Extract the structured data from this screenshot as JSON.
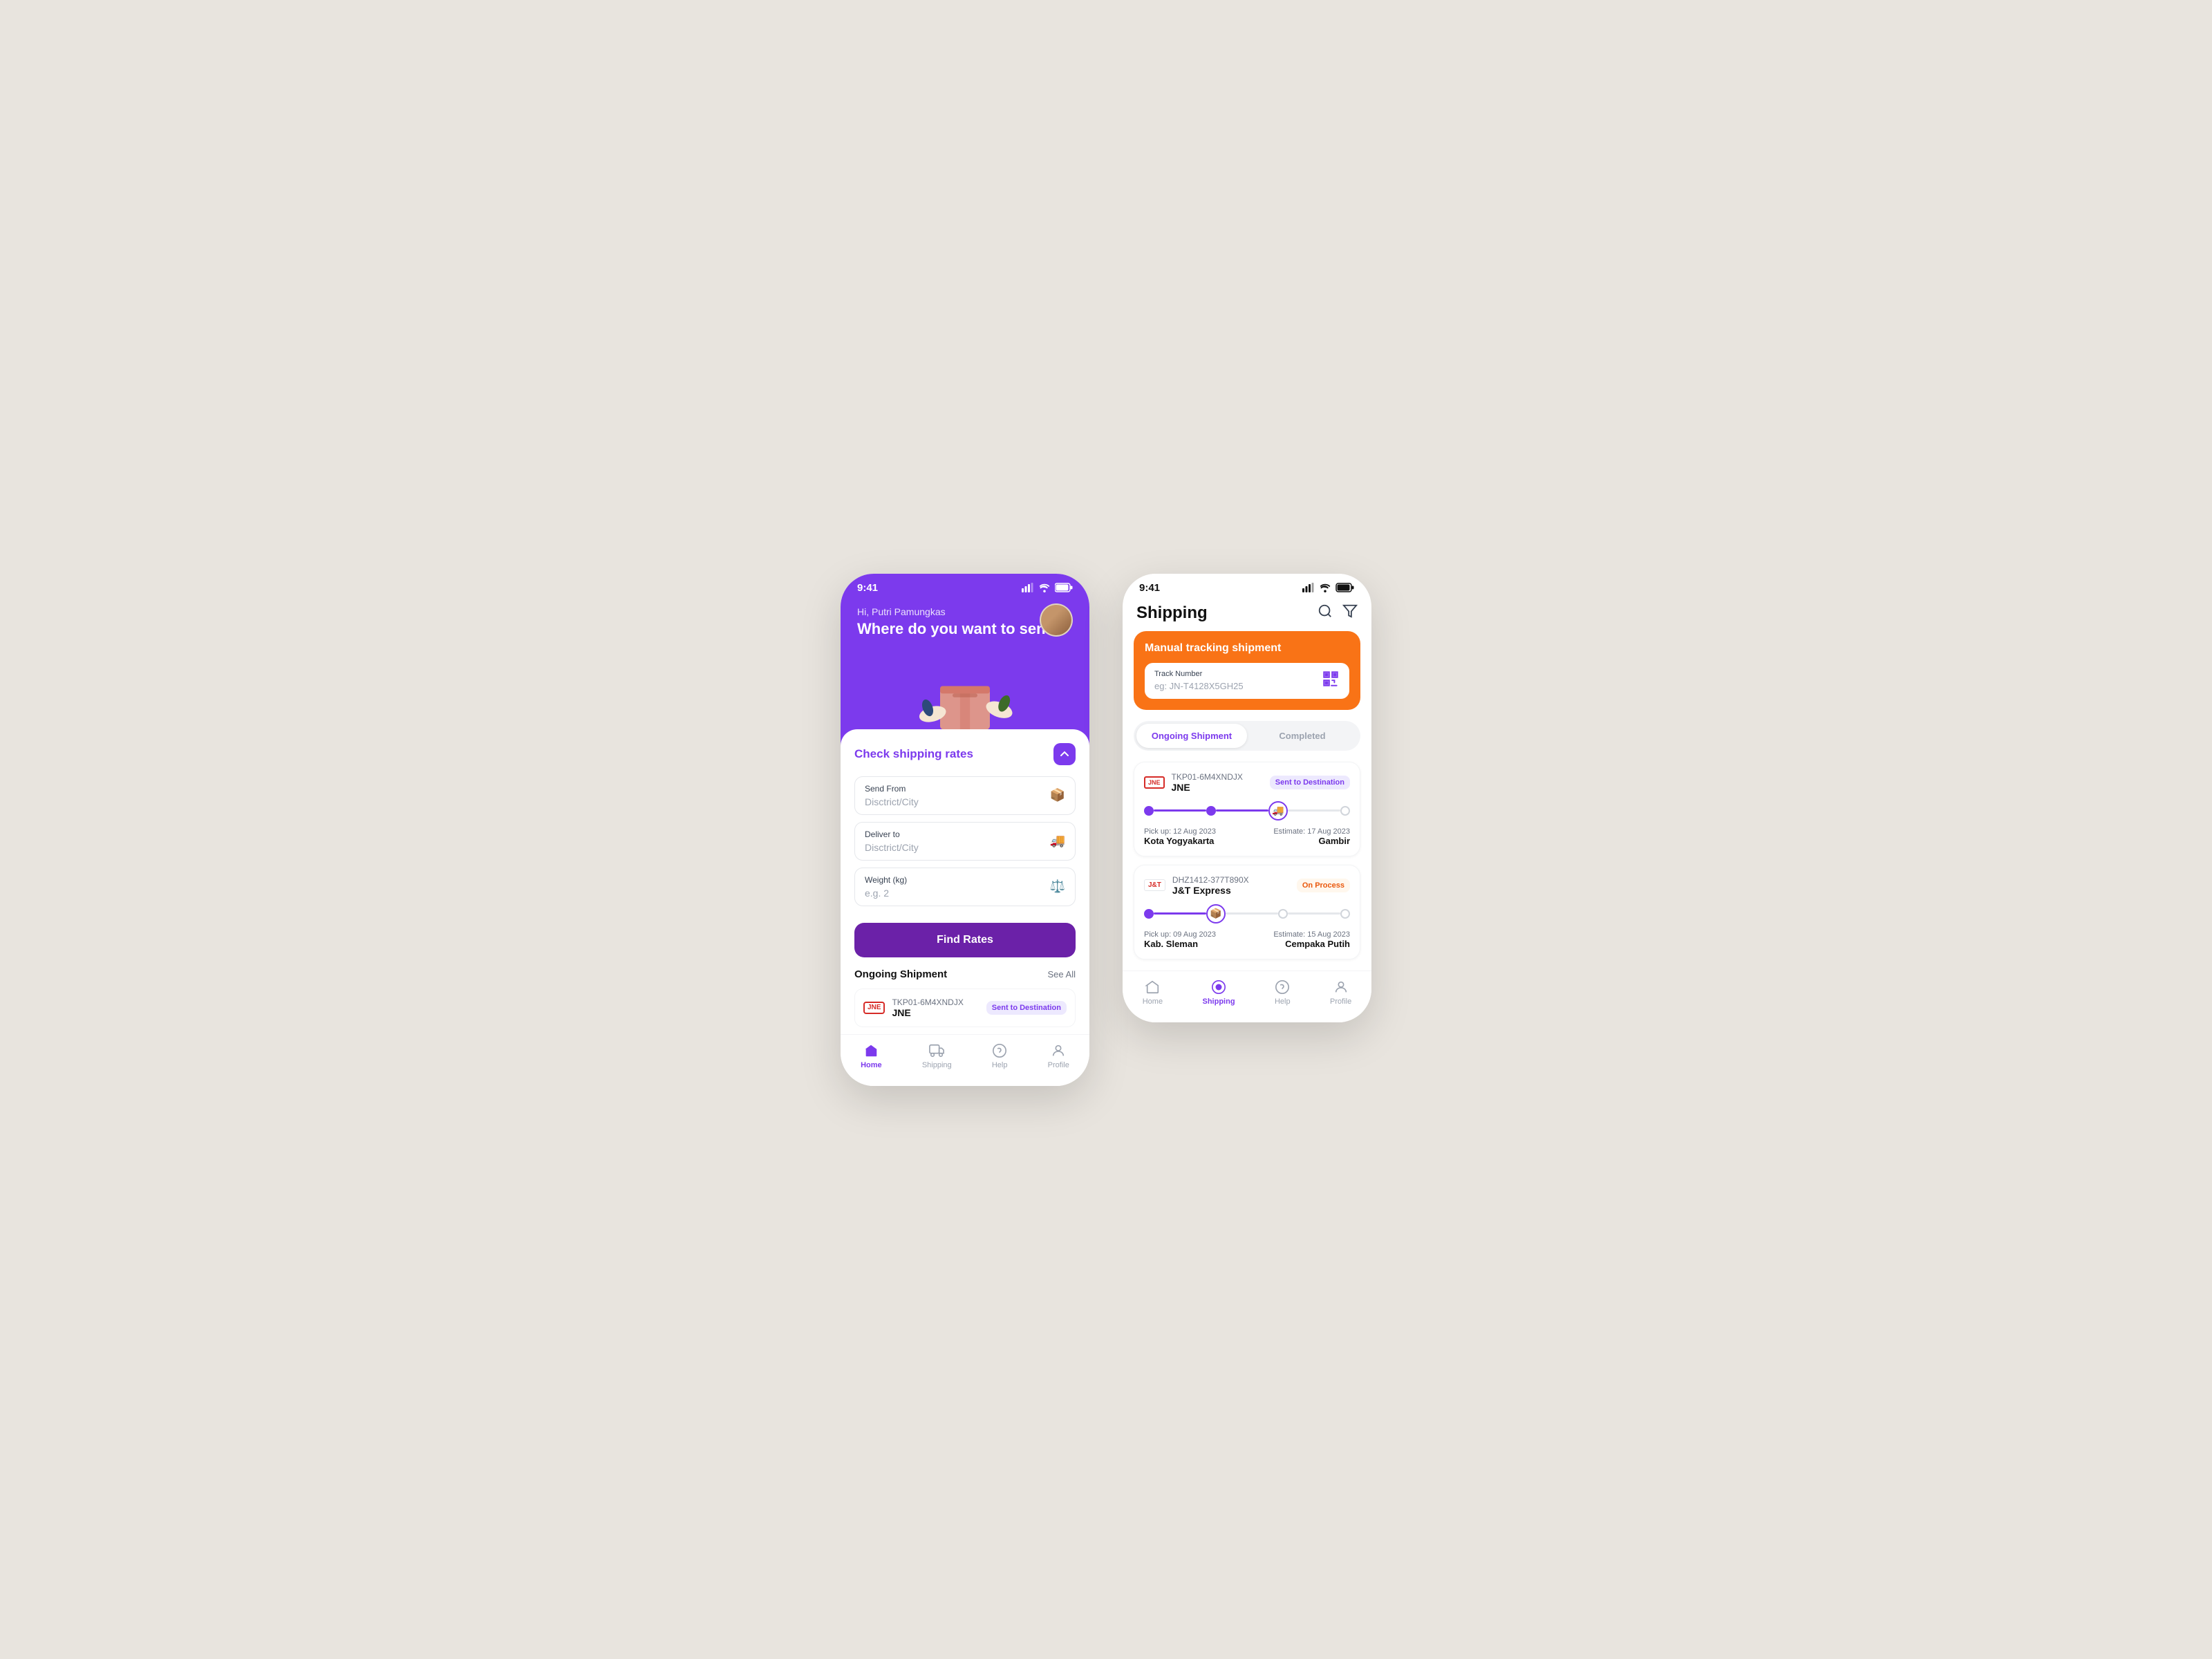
{
  "app": {
    "left_phone": {
      "status_bar": {
        "time": "9:41",
        "signal": "▌▌▌",
        "wifi": "◈",
        "battery": "▬"
      },
      "hero": {
        "greeting": "Hi, Putri Pamungkas",
        "question": "Where do you want to send?",
        "avatar_alt": "user avatar"
      },
      "check_rates": {
        "title": "Check shipping rates",
        "toggle_icon": "chevron-up",
        "send_from_label": "Send From",
        "send_from_placeholder": "Disctrict/City",
        "deliver_to_label": "Deliver to",
        "deliver_to_placeholder": "Disctrict/City",
        "weight_label": "Weight (kg)",
        "weight_placeholder": "e.g. 2",
        "find_rates_button": "Find Rates"
      },
      "ongoing_shipment": {
        "title": "Ongoing Shipment",
        "see_all": "See All",
        "items": [
          {
            "tracking_num": "TKP01-6M4XNDJX",
            "carrier": "JNE",
            "status": "Sent to Destination",
            "status_type": "blue"
          }
        ]
      },
      "bottom_nav": {
        "items": [
          {
            "icon": "🏠",
            "label": "Home",
            "active": true
          },
          {
            "icon": "📦",
            "label": "Shipping",
            "active": false
          },
          {
            "icon": "🙂",
            "label": "Help",
            "active": false
          },
          {
            "icon": "👤",
            "label": "Profile",
            "active": false
          }
        ]
      }
    },
    "right_phone": {
      "status_bar": {
        "time": "9:41",
        "signal": "▌▌▌",
        "wifi": "◈",
        "battery": "▬"
      },
      "header": {
        "title": "Shipping",
        "search_icon": "search",
        "filter_icon": "filter"
      },
      "tracking": {
        "title": "Manual tracking shipment",
        "input_label": "Track Number",
        "input_placeholder": "eg: JN-T4128X5GH25",
        "qr_icon": "qr"
      },
      "tabs": [
        {
          "label": "Ongoing Shipment",
          "active": true
        },
        {
          "label": "Completed",
          "active": false
        }
      ],
      "shipments": [
        {
          "carrier_code": "JNE",
          "tracking_num": "TKP01-6M4XNDJX",
          "carrier_name": "JNE",
          "status": "Sent to Destination",
          "status_type": "blue",
          "progress": 75,
          "pickup_date": "Pick up: 12 Aug 2023",
          "pickup_city": "Kota Yogyakarta",
          "estimate_date": "Estimate: 17 Aug 2023",
          "estimate_city": "Gambir"
        },
        {
          "carrier_code": "J&T",
          "tracking_num": "DHZ1412-377T890X",
          "carrier_name": "J&T Express",
          "status": "On Process",
          "status_type": "orange",
          "progress": 40,
          "pickup_date": "Pick up: 09 Aug 2023",
          "pickup_city": "Kab. Sleman",
          "estimate_date": "Estimate: 15 Aug 2023",
          "estimate_city": "Cempaka Putih"
        }
      ],
      "bottom_nav": {
        "items": [
          {
            "icon": "🏠",
            "label": "Home",
            "active": false
          },
          {
            "icon": "📦",
            "label": "Shipping",
            "active": true
          },
          {
            "icon": "🙂",
            "label": "Help",
            "active": false
          },
          {
            "icon": "👤",
            "label": "Profile",
            "active": false
          }
        ]
      }
    }
  }
}
